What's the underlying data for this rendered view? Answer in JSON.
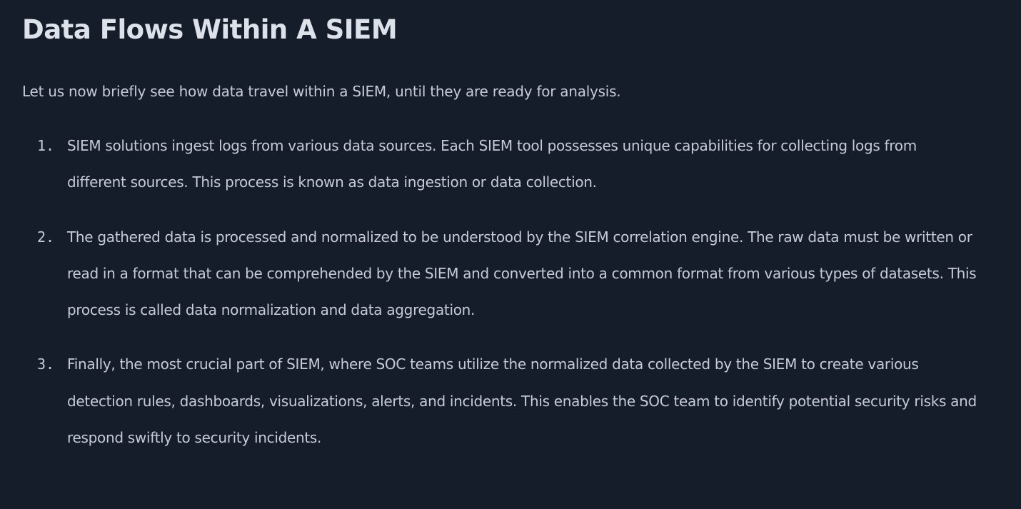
{
  "article": {
    "title": "Data Flows Within A SIEM",
    "intro": "Let us now briefly see how data travel within a SIEM, until they are ready for analysis.",
    "steps": [
      {
        "number": "1.",
        "text": "SIEM solutions ingest logs from various data sources. Each SIEM tool possesses unique capabilities for collecting logs from different sources. This process is known as data ingestion or data collection."
      },
      {
        "number": "2.",
        "text": "The gathered data is processed and normalized to be understood by the SIEM correlation engine. The raw data must be written or read in a format that can be comprehended by the SIEM and converted into a common format from various types of datasets. This process is called data normalization and data aggregation."
      },
      {
        "number": "3.",
        "text": "Finally, the most crucial part of SIEM, where SOC teams utilize the normalized data collected by the SIEM to create various detection rules, dashboards, visualizations, alerts, and incidents. This enables the SOC team to identify potential security risks and respond swiftly to security incidents."
      }
    ]
  }
}
